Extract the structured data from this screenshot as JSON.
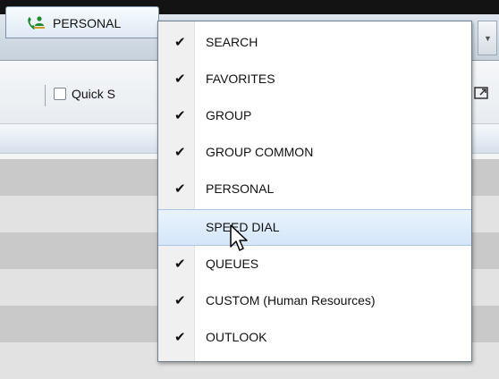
{
  "directory_tab": {
    "label": "PERSONAL",
    "icon": "phone-person-icon"
  },
  "toolbar": {
    "quick_search_label": "Quick S"
  },
  "menu": {
    "items": [
      {
        "label": "SEARCH",
        "checked": true
      },
      {
        "label": "FAVORITES",
        "checked": true
      },
      {
        "label": "GROUP",
        "checked": true
      },
      {
        "label": "GROUP COMMON",
        "checked": true
      },
      {
        "label": "PERSONAL",
        "checked": true
      },
      {
        "label": "SPEED DIAL",
        "checked": false,
        "highlighted": true
      },
      {
        "label": "QUEUES",
        "checked": true
      },
      {
        "label": "CUSTOM (Human Resources)",
        "checked": true
      },
      {
        "label": "OUTLOOK",
        "checked": true
      }
    ],
    "check_glyph": "✔"
  },
  "colors": {
    "accent": "#1f8a2e",
    "highlight": "#d4e6f9"
  }
}
